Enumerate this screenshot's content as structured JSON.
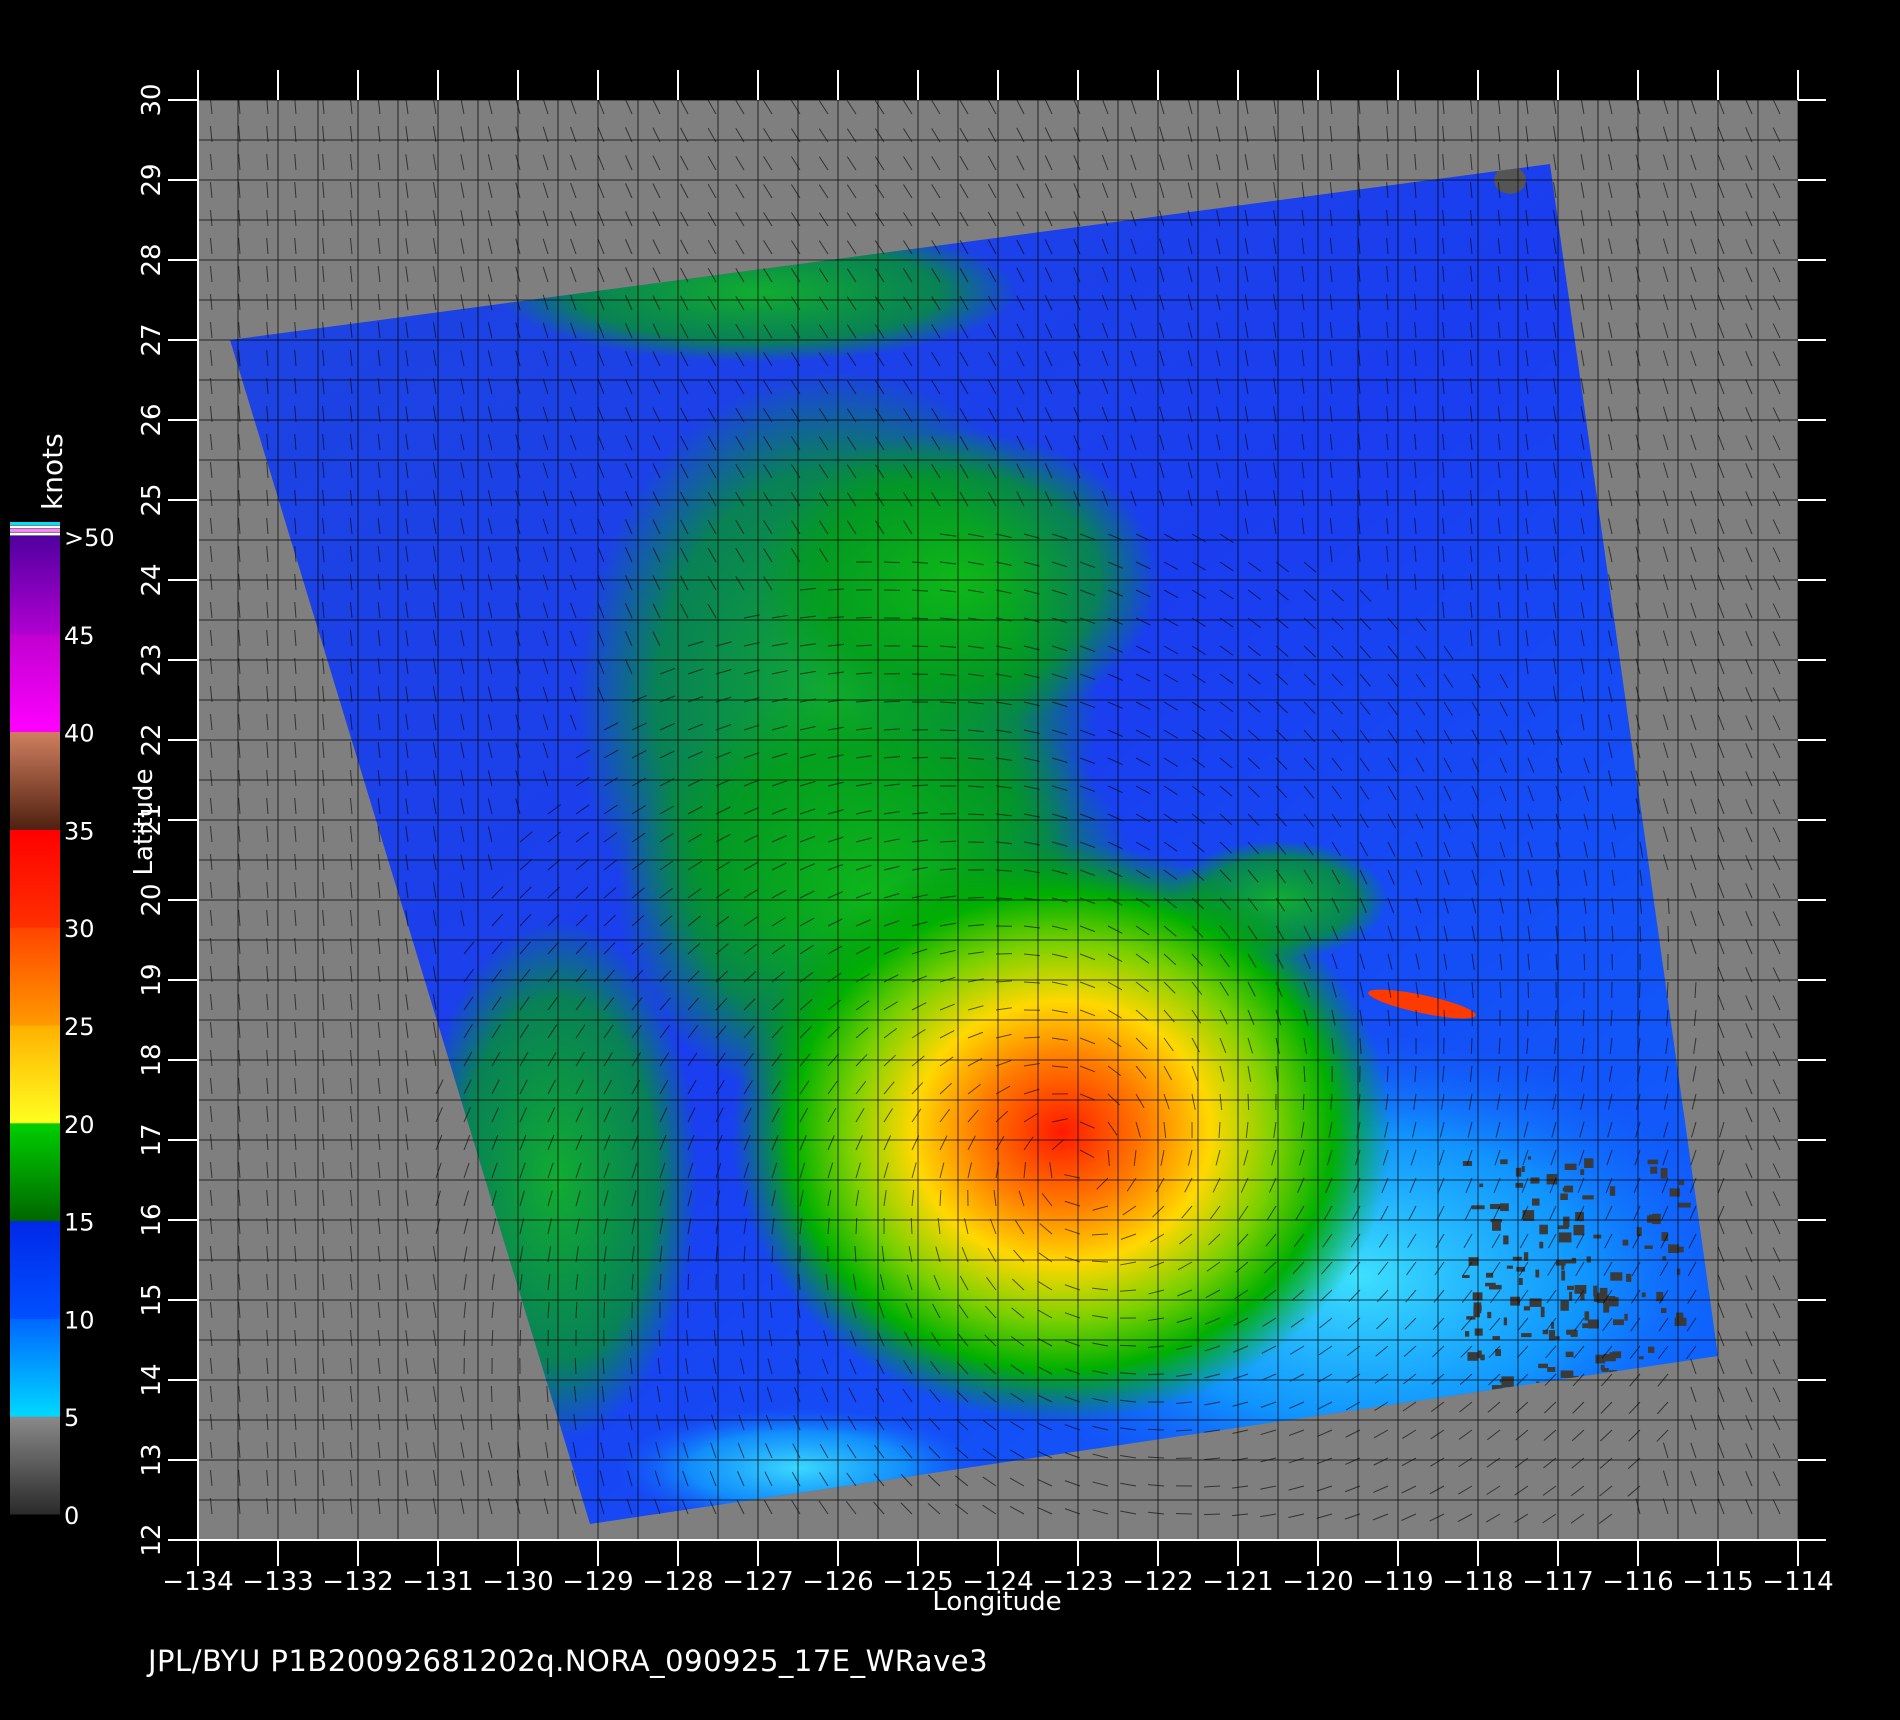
{
  "units_label": "knots",
  "colorbar": {
    "labels": [
      "0",
      "5",
      "10",
      "15",
      "20",
      "25",
      "30",
      "35",
      "40",
      "45",
      ">50"
    ],
    "colors": {
      "band_0_5": [
        "#2a2a2a",
        "#8a8a8a"
      ],
      "band_5_10": [
        "#00d8ff",
        "#0066ff"
      ],
      "band_10_15": [
        "#0050ff",
        "#0028e8"
      ],
      "band_15_20": [
        "#006600",
        "#00d000"
      ],
      "band_20_25": [
        "#ffff20",
        "#ffb000"
      ],
      "band_25_30": [
        "#ff9a00",
        "#ff4400"
      ],
      "band_30_35": [
        "#ff3000",
        "#ff0000"
      ],
      "band_35_40": [
        "#502010",
        "#d08060"
      ],
      "band_40_45": [
        "#ff00ff",
        "#c000d0"
      ],
      "band_45_50": [
        "#b000d0",
        "#5000a0"
      ]
    },
    "top_marker_colors": [
      "#00e0ff",
      "#ffffff",
      "#ff80ff",
      "#ffffff"
    ]
  },
  "map": {
    "background": "#7f7f7f",
    "grid_color": "#000000",
    "longitude_range": [
      -134,
      -114
    ],
    "latitude_range": [
      12,
      30
    ],
    "x_ticks": [
      "−134",
      "−133",
      "−132",
      "−131",
      "−130",
      "−129",
      "−128",
      "−127",
      "−126",
      "−125",
      "−124",
      "−123",
      "−122",
      "−121",
      "−120",
      "−119",
      "−118",
      "−117",
      "−116",
      "−115",
      "−114"
    ],
    "y_ticks": [
      "12",
      "13",
      "14",
      "15",
      "16",
      "17",
      "18",
      "19",
      "20",
      "21",
      "22",
      "23",
      "24",
      "25",
      "26",
      "27",
      "28",
      "29",
      "30"
    ],
    "xlabel": "Longitude",
    "ylabel": "Latitude",
    "swath_corners_lonlat": [
      [
        -133.6,
        27.0
      ],
      [
        -117.1,
        29.2
      ],
      [
        -115.0,
        14.3
      ],
      [
        -129.1,
        12.2
      ]
    ],
    "storm_center_lonlat": [
      -123.0,
      16.7
    ]
  },
  "footer": "JPL/BYU   P1B20092681202q.NORA_090925_17E_WRave3"
}
